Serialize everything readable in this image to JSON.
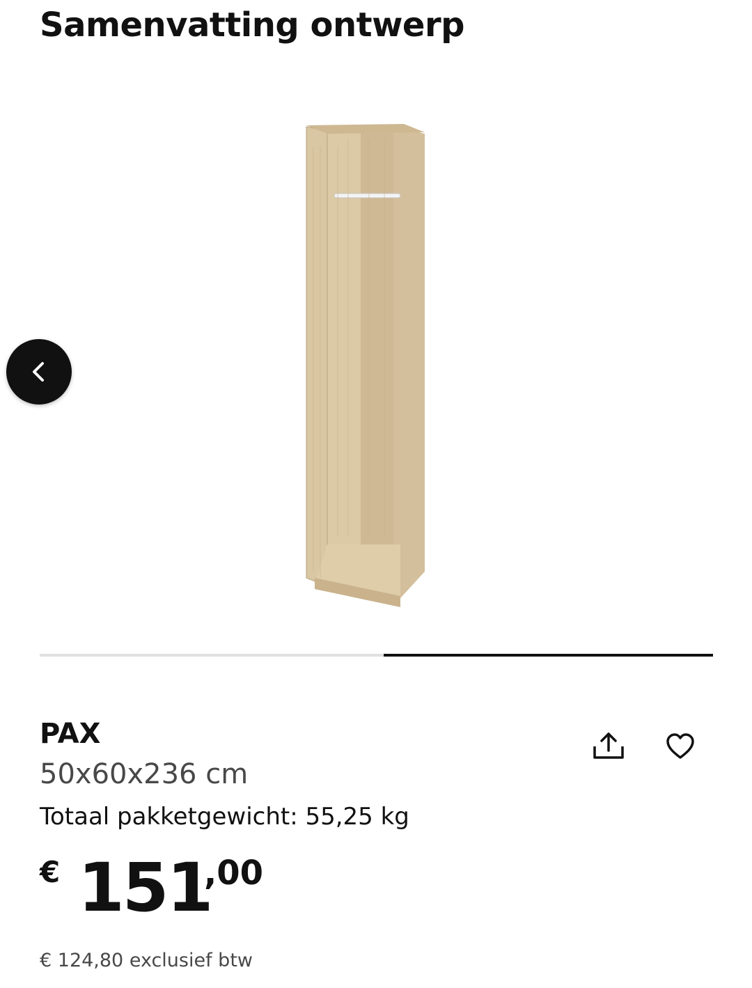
{
  "header": {
    "title": "Samenvatting ontwerp"
  },
  "carousel": {
    "back_icon": "chevron-left-icon",
    "image_subject": "open wardrobe frame with clothes rail, white stained oak effect",
    "progress": 0.5
  },
  "product": {
    "name": "PAX",
    "dimensions": "50x60x236 cm",
    "weight": "Totaal pakketgewicht: 55,25 kg",
    "actions": {
      "share_icon": "share-icon",
      "favorite_icon": "heart-icon"
    },
    "price": {
      "currency": "€",
      "integer": "151",
      "decimal": ",00",
      "excl_vat": "€  124,80 exclusief btw"
    }
  },
  "colors": {
    "text": "#111111",
    "muted": "#484848",
    "track": "#e0e0e0",
    "wood": "#d6c3a0"
  }
}
